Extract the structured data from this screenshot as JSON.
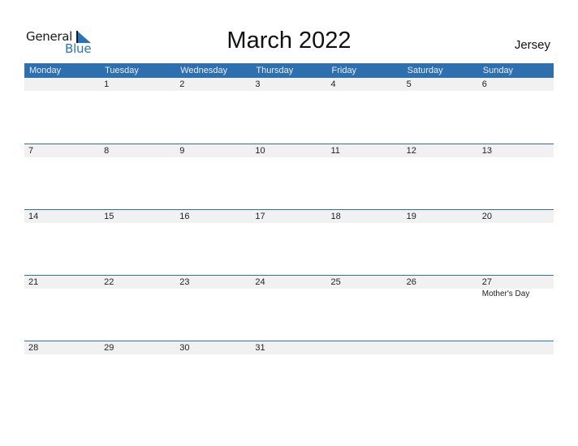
{
  "logo": {
    "line1": "General",
    "line2": "Blue"
  },
  "title": "March 2022",
  "region": "Jersey",
  "colors": {
    "accent": "#2e6fb0",
    "band": "#f1f1f1"
  },
  "weekdays": [
    "Monday",
    "Tuesday",
    "Wednesday",
    "Thursday",
    "Friday",
    "Saturday",
    "Sunday"
  ],
  "weeks": [
    [
      {
        "day": ""
      },
      {
        "day": "1"
      },
      {
        "day": "2"
      },
      {
        "day": "3"
      },
      {
        "day": "4"
      },
      {
        "day": "5"
      },
      {
        "day": "6"
      }
    ],
    [
      {
        "day": "7"
      },
      {
        "day": "8"
      },
      {
        "day": "9"
      },
      {
        "day": "10"
      },
      {
        "day": "11"
      },
      {
        "day": "12"
      },
      {
        "day": "13"
      }
    ],
    [
      {
        "day": "14"
      },
      {
        "day": "15"
      },
      {
        "day": "16"
      },
      {
        "day": "17"
      },
      {
        "day": "18"
      },
      {
        "day": "19"
      },
      {
        "day": "20"
      }
    ],
    [
      {
        "day": "21"
      },
      {
        "day": "22"
      },
      {
        "day": "23"
      },
      {
        "day": "24"
      },
      {
        "day": "25"
      },
      {
        "day": "26"
      },
      {
        "day": "27",
        "event": "Mother's Day"
      }
    ],
    [
      {
        "day": "28"
      },
      {
        "day": "29"
      },
      {
        "day": "30"
      },
      {
        "day": "31"
      },
      {
        "day": ""
      },
      {
        "day": ""
      },
      {
        "day": ""
      }
    ]
  ]
}
